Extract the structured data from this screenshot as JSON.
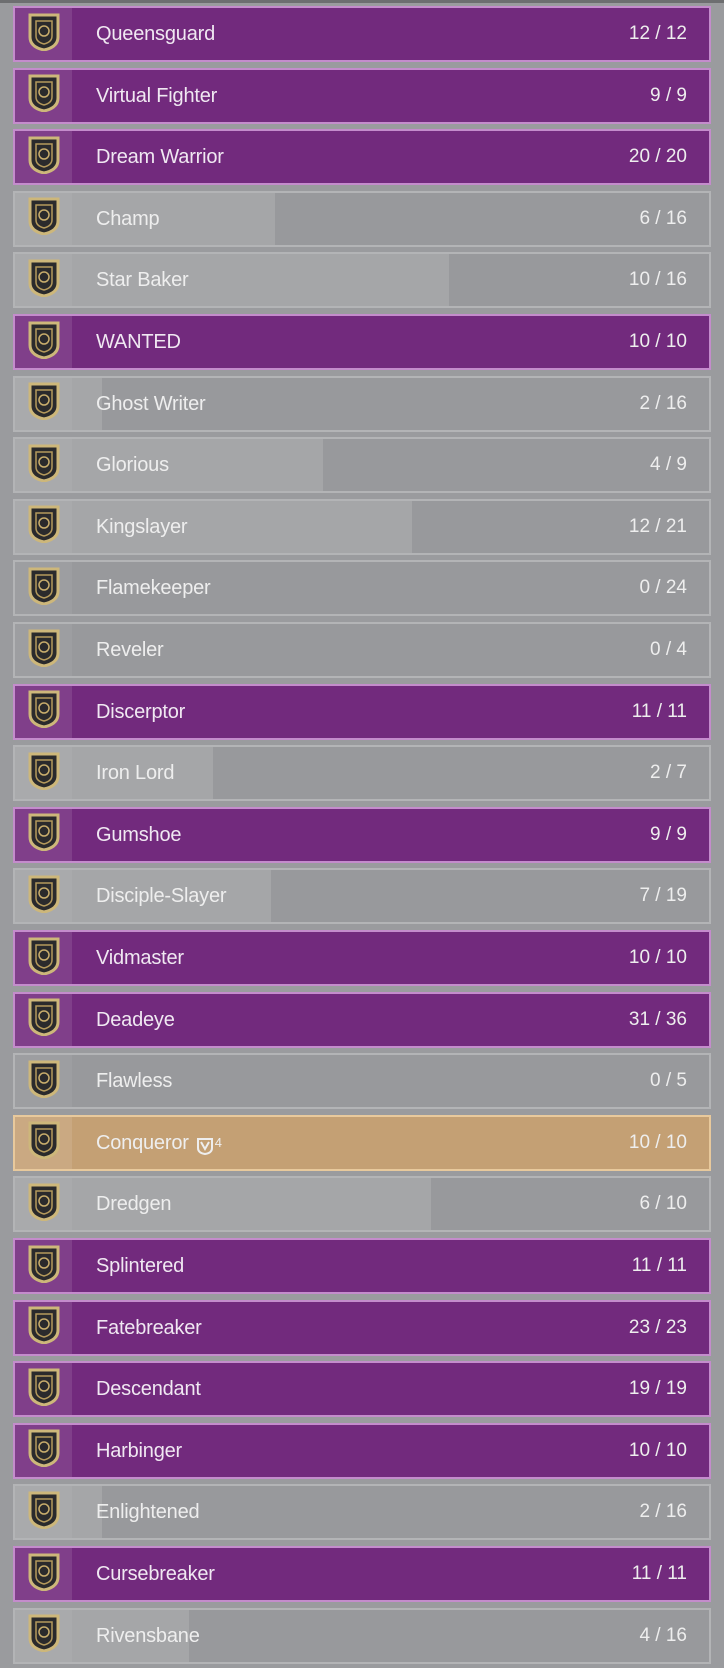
{
  "colors": {
    "complete": "#722a7d",
    "gilded": "#c4a074",
    "incomplete": "#98999c",
    "progress_fill": "#a5a6a8",
    "background": "#9a9b9e"
  },
  "seals": [
    {
      "name": "Queensguard",
      "progress": 12,
      "total": 12,
      "count": "12 / 12",
      "state": "complete",
      "icon": "seal-emblem-icon"
    },
    {
      "name": "Virtual Fighter",
      "progress": 9,
      "total": 9,
      "count": "9 / 9",
      "state": "complete",
      "icon": "seal-emblem-icon"
    },
    {
      "name": "Dream Warrior",
      "progress": 20,
      "total": 20,
      "count": "20 / 20",
      "state": "complete",
      "icon": "seal-emblem-icon"
    },
    {
      "name": "Champ",
      "progress": 6,
      "total": 16,
      "count": "6 / 16",
      "state": "incomplete",
      "icon": "seal-emblem-icon"
    },
    {
      "name": "Star Baker",
      "progress": 10,
      "total": 16,
      "count": "10 / 16",
      "state": "incomplete",
      "icon": "seal-emblem-icon"
    },
    {
      "name": "WANTED",
      "progress": 10,
      "total": 10,
      "count": "10 / 10",
      "state": "complete",
      "icon": "seal-emblem-icon"
    },
    {
      "name": "Ghost Writer",
      "progress": 2,
      "total": 16,
      "count": "2 / 16",
      "state": "incomplete",
      "icon": "seal-emblem-icon"
    },
    {
      "name": "Glorious",
      "progress": 4,
      "total": 9,
      "count": "4 / 9",
      "state": "incomplete",
      "icon": "seal-emblem-icon"
    },
    {
      "name": "Kingslayer",
      "progress": 12,
      "total": 21,
      "count": "12 / 21",
      "state": "incomplete",
      "icon": "seal-emblem-icon"
    },
    {
      "name": "Flamekeeper",
      "progress": 0,
      "total": 24,
      "count": "0 / 24",
      "state": "incomplete",
      "icon": "seal-emblem-icon"
    },
    {
      "name": "Reveler",
      "progress": 0,
      "total": 4,
      "count": "0 / 4",
      "state": "incomplete",
      "icon": "seal-emblem-icon"
    },
    {
      "name": "Discerptor",
      "progress": 11,
      "total": 11,
      "count": "11 / 11",
      "state": "complete",
      "icon": "seal-emblem-icon"
    },
    {
      "name": "Iron Lord",
      "progress": 2,
      "total": 7,
      "count": "2 / 7",
      "state": "incomplete",
      "icon": "seal-emblem-icon"
    },
    {
      "name": "Gumshoe",
      "progress": 9,
      "total": 9,
      "count": "9 / 9",
      "state": "complete",
      "icon": "seal-emblem-icon"
    },
    {
      "name": "Disciple-Slayer",
      "progress": 7,
      "total": 19,
      "count": "7 / 19",
      "state": "incomplete",
      "icon": "seal-emblem-icon"
    },
    {
      "name": "Vidmaster",
      "progress": 10,
      "total": 10,
      "count": "10 / 10",
      "state": "complete",
      "icon": "seal-emblem-icon"
    },
    {
      "name": "Deadeye",
      "progress": 31,
      "total": 36,
      "count": "31 / 36",
      "state": "complete",
      "icon": "seal-emblem-icon"
    },
    {
      "name": "Flawless",
      "progress": 0,
      "total": 5,
      "count": "0 / 5",
      "state": "incomplete",
      "icon": "seal-emblem-icon"
    },
    {
      "name": "Conqueror",
      "progress": 10,
      "total": 10,
      "count": "10 / 10",
      "state": "gilded",
      "icon": "seal-emblem-icon",
      "gild_count": "4",
      "gild_icon": "gilded-shield-icon"
    },
    {
      "name": "Dredgen",
      "progress": 6,
      "total": 10,
      "count": "6 / 10",
      "state": "incomplete",
      "icon": "seal-emblem-icon"
    },
    {
      "name": "Splintered",
      "progress": 11,
      "total": 11,
      "count": "11 / 11",
      "state": "complete",
      "icon": "seal-emblem-icon"
    },
    {
      "name": "Fatebreaker",
      "progress": 23,
      "total": 23,
      "count": "23 / 23",
      "state": "complete",
      "icon": "seal-emblem-icon"
    },
    {
      "name": "Descendant",
      "progress": 19,
      "total": 19,
      "count": "19 / 19",
      "state": "complete",
      "icon": "seal-emblem-icon"
    },
    {
      "name": "Harbinger",
      "progress": 10,
      "total": 10,
      "count": "10 / 10",
      "state": "complete",
      "icon": "seal-emblem-icon"
    },
    {
      "name": "Enlightened",
      "progress": 2,
      "total": 16,
      "count": "2 / 16",
      "state": "incomplete",
      "icon": "seal-emblem-icon"
    },
    {
      "name": "Cursebreaker",
      "progress": 11,
      "total": 11,
      "count": "11 / 11",
      "state": "complete",
      "icon": "seal-emblem-icon"
    },
    {
      "name": "Rivensbane",
      "progress": 4,
      "total": 16,
      "count": "4 / 16",
      "state": "incomplete",
      "icon": "seal-emblem-icon"
    }
  ]
}
